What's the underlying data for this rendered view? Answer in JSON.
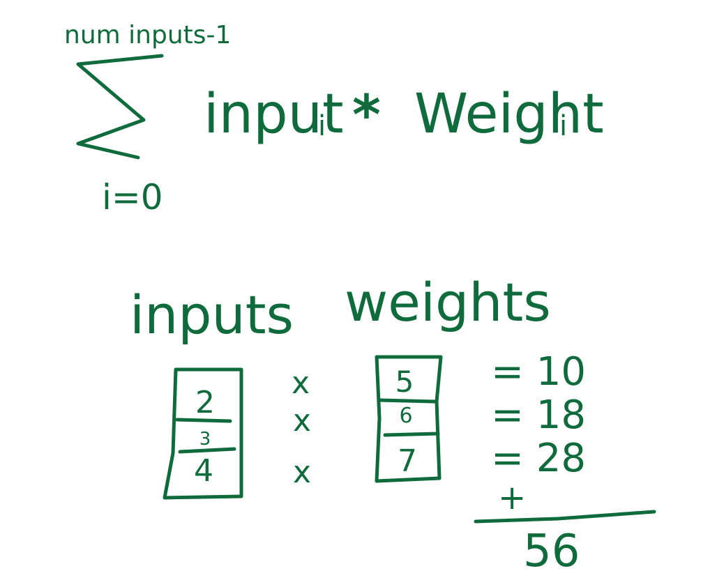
{
  "formula": {
    "upper_limit": "num inputs-1",
    "lower_limit": "i=0",
    "term": "input",
    "term_subscript": "i",
    "operator": "*",
    "weight": "Weight",
    "weight_subscript": "i"
  },
  "labels": {
    "inputs": "inputs",
    "weights": "weights"
  },
  "inputs": [
    "2",
    "3",
    "4"
  ],
  "weights": [
    "5",
    "6",
    "7"
  ],
  "multiply_signs": [
    "x",
    "x",
    "x"
  ],
  "products": [
    "= 10",
    "= 18",
    "= 28"
  ],
  "plus": "+",
  "total": "56",
  "ink_color": "#0f6b3c"
}
